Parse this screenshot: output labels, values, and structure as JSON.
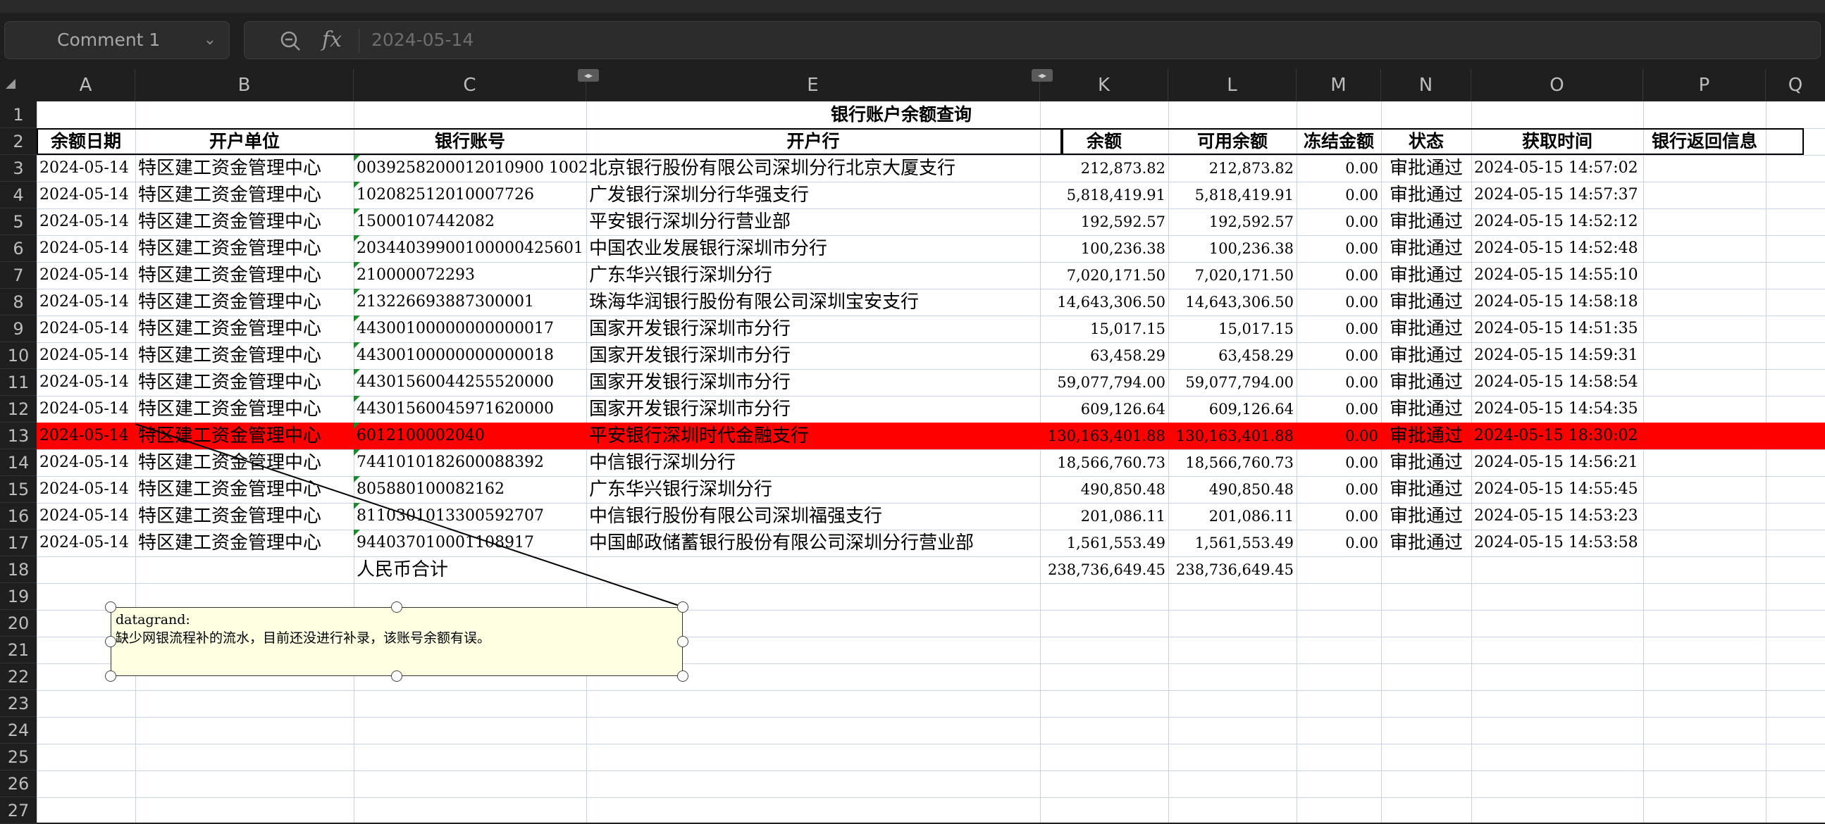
{
  "name_box": {
    "value": "Comment 1"
  },
  "formula_bar": {
    "fx_label": "fx",
    "value": "2024-05-14"
  },
  "columns": [
    "A",
    "B",
    "C",
    "E",
    "K",
    "L",
    "M",
    "N",
    "O",
    "P",
    "Q"
  ],
  "row_numbers": [
    "1",
    "2",
    "3",
    "4",
    "5",
    "6",
    "7",
    "8",
    "9",
    "10",
    "11",
    "12",
    "13",
    "14",
    "15",
    "16",
    "17",
    "18",
    "19",
    "20",
    "21",
    "22",
    "23",
    "24",
    "25",
    "26",
    "27"
  ],
  "table": {
    "title": "银行账户余额查询",
    "headers": [
      "余额日期",
      "开户单位",
      "银行账号",
      "开户行",
      "余额",
      "可用余额",
      "冻结金额",
      "状态",
      "获取时间",
      "银行返回信息"
    ],
    "rows": [
      [
        "2024-05-14",
        "特区建工资金管理中心",
        "0039258200012010900 1002",
        "北京银行股份有限公司深圳分行北京大厦支行",
        "212,873.82",
        "212,873.82",
        "0.00",
        "审批通过",
        "2024-05-15 14:57:02"
      ],
      [
        "2024-05-14",
        "特区建工资金管理中心",
        "102082512010007726",
        "广发银行深圳分行华强支行",
        "5,818,419.91",
        "5,818,419.91",
        "0.00",
        "审批通过",
        "2024-05-15 14:57:37"
      ],
      [
        "2024-05-14",
        "特区建工资金管理中心",
        "15000107442082",
        "平安银行深圳分行营业部",
        "192,592.57",
        "192,592.57",
        "0.00",
        "审批通过",
        "2024-05-15 14:52:12"
      ],
      [
        "2024-05-14",
        "特区建工资金管理中心",
        "20344039900100000425601",
        "中国农业发展银行深圳市分行",
        "100,236.38",
        "100,236.38",
        "0.00",
        "审批通过",
        "2024-05-15 14:52:48"
      ],
      [
        "2024-05-14",
        "特区建工资金管理中心",
        "210000072293",
        "广东华兴银行深圳分行",
        "7,020,171.50",
        "7,020,171.50",
        "0.00",
        "审批通过",
        "2024-05-15 14:55:10"
      ],
      [
        "2024-05-14",
        "特区建工资金管理中心",
        "213226693887300001",
        "珠海华润银行股份有限公司深圳宝安支行",
        "14,643,306.50",
        "14,643,306.50",
        "0.00",
        "审批通过",
        "2024-05-15 14:58:18"
      ],
      [
        "2024-05-14",
        "特区建工资金管理中心",
        "44300100000000000017",
        "国家开发银行深圳市分行",
        "15,017.15",
        "15,017.15",
        "0.00",
        "审批通过",
        "2024-05-15 14:51:35"
      ],
      [
        "2024-05-14",
        "特区建工资金管理中心",
        "44300100000000000018",
        "国家开发银行深圳市分行",
        "63,458.29",
        "63,458.29",
        "0.00",
        "审批通过",
        "2024-05-15 14:59:31"
      ],
      [
        "2024-05-14",
        "特区建工资金管理中心",
        "44301560044255520000",
        "国家开发银行深圳市分行",
        "59,077,794.00",
        "59,077,794.00",
        "0.00",
        "审批通过",
        "2024-05-15 14:58:54"
      ],
      [
        "2024-05-14",
        "特区建工资金管理中心",
        "44301560045971620000",
        "国家开发银行深圳市分行",
        "609,126.64",
        "609,126.64",
        "0.00",
        "审批通过",
        "2024-05-15 14:54:35"
      ],
      [
        "2024-05-14",
        "特区建工资金管理中心",
        "6012100002040",
        "平安银行深圳时代金融支行",
        "130,163,401.88",
        "130,163,401.88",
        "0.00",
        "审批通过",
        "2024-05-15 18:30:02"
      ],
      [
        "2024-05-14",
        "特区建工资金管理中心",
        "7441010182600088392",
        "中信银行深圳分行",
        "18,566,760.73",
        "18,566,760.73",
        "0.00",
        "审批通过",
        "2024-05-15 14:56:21"
      ],
      [
        "2024-05-14",
        "特区建工资金管理中心",
        "805880100082162",
        "广东华兴银行深圳分行",
        "490,850.48",
        "490,850.48",
        "0.00",
        "审批通过",
        "2024-05-15 14:55:45"
      ],
      [
        "2024-05-14",
        "特区建工资金管理中心",
        "8110301013300592707",
        "中信银行股份有限公司深圳福强支行",
        "201,086.11",
        "201,086.11",
        "0.00",
        "审批通过",
        "2024-05-15 14:53:23"
      ],
      [
        "2024-05-14",
        "特区建工资金管理中心",
        "944037010001108917",
        "中国邮政储蓄银行股份有限公司深圳分行营业部",
        "1,561,553.49",
        "1,561,553.49",
        "0.00",
        "审批通过",
        "2024-05-15 14:53:58"
      ]
    ],
    "highlighted_row_index": 10,
    "total": {
      "label": "人民币合计",
      "balance": "238,736,649.45",
      "available": "238,736,649.45"
    }
  },
  "comment": {
    "author": "datagrand:",
    "text": "缺少网银流程补的流水，目前还没进行补录，该账号余额有误。"
  },
  "colors": {
    "highlight": "#ff0000",
    "comment_bg": "#ffffe1",
    "gridline": "#c9d3e6",
    "header_bg": "#1f1f1f"
  }
}
